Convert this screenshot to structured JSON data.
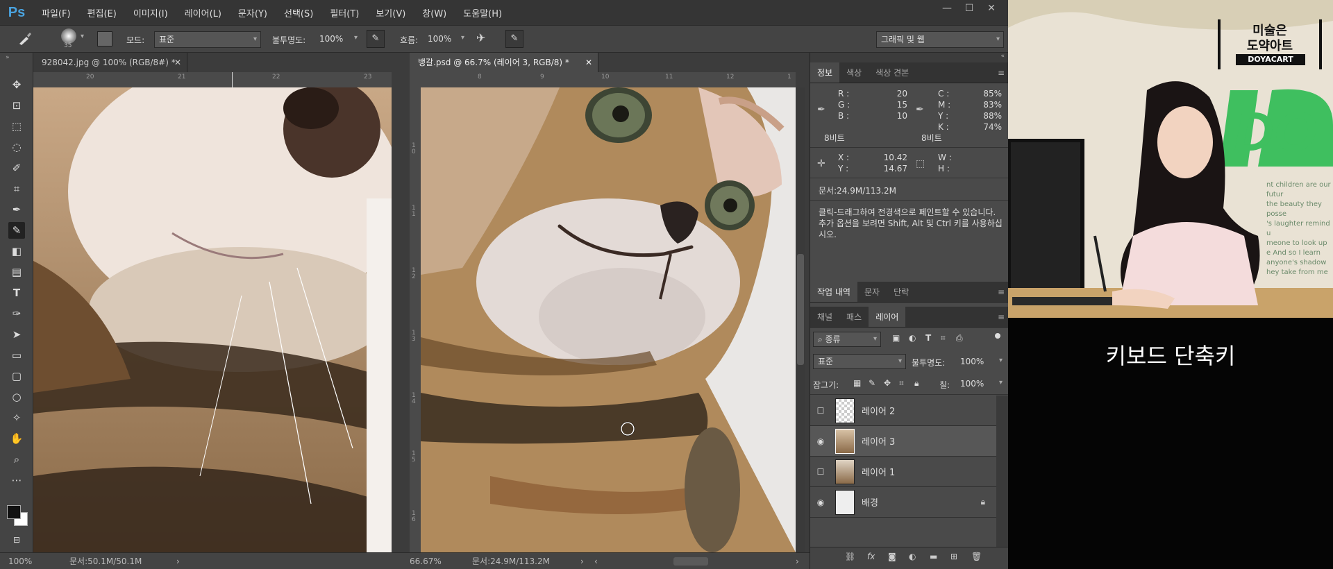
{
  "app": {
    "logo": "Ps"
  },
  "menu": [
    "파일(F)",
    "편집(E)",
    "이미지(I)",
    "레이어(L)",
    "문자(Y)",
    "선택(S)",
    "필터(T)",
    "보기(V)",
    "창(W)",
    "도움말(H)"
  ],
  "window_controls": [
    "—",
    "☐",
    "✕"
  ],
  "options": {
    "brush_size": "35",
    "mode_label": "모드:",
    "mode_value": "표준",
    "opacity_label": "불투명도:",
    "opacity_value": "100%",
    "flow_label": "흐름:",
    "flow_value": "100%",
    "workspace": "그래픽 및 웹"
  },
  "documents": [
    {
      "tab": "928042.jpg @ 100% (RGB/8#) *",
      "close": "✕",
      "zoom": "100%",
      "status": "문서:50.1M/50.1M",
      "ruler_marks": [
        "20",
        "21",
        "22",
        "23"
      ]
    },
    {
      "tab": "뱅갈.psd @ 66.7% (레이어 3, RGB/8) *",
      "close": "✕",
      "zoom": "66.67%",
      "status": "문서:24.9M/113.2M",
      "ruler_marks": [
        "8",
        "9",
        "10",
        "11",
        "12",
        "1"
      ],
      "vruler_marks": [
        "1\n0",
        "1\n1",
        "1\n2",
        "1\n3",
        "1\n4",
        "1\n5",
        "1\n6"
      ]
    }
  ],
  "info_panel": {
    "tabs": [
      "정보",
      "색상",
      "색상 견본"
    ],
    "rgb": [
      {
        "k": "R :",
        "v": "20"
      },
      {
        "k": "G :",
        "v": "15"
      },
      {
        "k": "B :",
        "v": "10"
      }
    ],
    "cmyk": [
      {
        "k": "C :",
        "v": "85%"
      },
      {
        "k": "M :",
        "v": "83%"
      },
      {
        "k": "Y :",
        "v": "88%"
      },
      {
        "k": "K :",
        "v": "74%"
      }
    ],
    "bit_left": "8비트",
    "bit_right": "8비트",
    "xy": [
      {
        "k": "X :",
        "v": "10.42"
      },
      {
        "k": "Y :",
        "v": "14.67"
      }
    ],
    "wh": [
      {
        "k": "W :",
        "v": ""
      },
      {
        "k": "H :",
        "v": ""
      }
    ],
    "doc_size": "문서:24.9M/113.2M",
    "hint": "클릭-드래그하여 전경색으로 페인트할 수 있습니다. 추가 옵션을 보려면 Shift, Alt 및 Ctrl 키를 사용하십시오."
  },
  "history_panel": {
    "tabs": [
      "작업 내역",
      "문자",
      "단락"
    ]
  },
  "layers_panel": {
    "tabs": [
      "채널",
      "패스",
      "레이어"
    ],
    "filter_label": "종류",
    "blend_mode": "표준",
    "opacity_label": "불투명도:",
    "opacity_value": "100%",
    "lock_label": "잠그기:",
    "fill_label": "칠:",
    "fill_value": "100%",
    "layers": [
      {
        "name": "레이어 2",
        "visible": false,
        "active": false
      },
      {
        "name": "레이어 3",
        "visible": true,
        "active": true
      },
      {
        "name": "레이어 1",
        "visible": false,
        "active": false
      },
      {
        "name": "배경",
        "visible": true,
        "active": false,
        "locked": true
      }
    ]
  },
  "video": {
    "logo_line1": "미술은",
    "logo_line2": "도약아트",
    "logo_line3": "DOYACART",
    "wall_text": "DO",
    "wall_small": [
      "nt children are our futur",
      "the beauty they posse",
      "'s laughter remind u",
      "meone to look up",
      "e And so I learn",
      "anyone's shadow",
      "hey take from me"
    ],
    "subtitle": "키보드 단축키"
  },
  "colors": {
    "ps_bg": "#3c3c3c",
    "accent": "#4aa3df",
    "green": "#3fbf5f"
  }
}
